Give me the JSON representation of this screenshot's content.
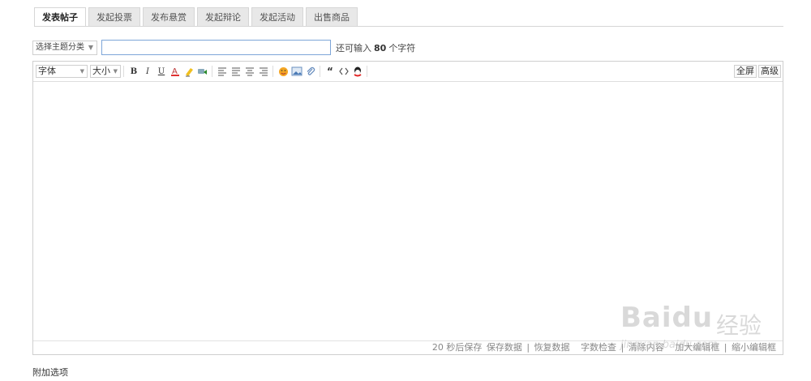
{
  "tabs": [
    {
      "label": "发表帖子",
      "active": true
    },
    {
      "label": "发起投票",
      "active": false
    },
    {
      "label": "发布悬赏",
      "active": false
    },
    {
      "label": "发起辩论",
      "active": false
    },
    {
      "label": "发起活动",
      "active": false
    },
    {
      "label": "出售商品",
      "active": false
    }
  ],
  "subject": {
    "category_select": "选择主题分类",
    "title_value": "",
    "remain_prefix": "还可输入",
    "remain_count": "80",
    "remain_suffix": "个字符"
  },
  "toolbar": {
    "font_select": "字体",
    "size_select": "大小",
    "bold": "B",
    "italic": "I",
    "underline": "U",
    "fullscreen": "全屏",
    "advanced": "高级"
  },
  "statusbar": {
    "autosave": "20 秒后保存",
    "save": "保存数据",
    "restore": "恢复数据",
    "count": "字数检查",
    "clear": "清除内容",
    "enlarge": "加大编辑框",
    "shrink": "缩小编辑框",
    "sep": "|"
  },
  "extra_options": "附加选项",
  "watermark": {
    "logo": "Baidu",
    "brand": "经验",
    "url": "jingyan.baidu.com"
  },
  "colors": {
    "tab_bg": "#e8e8e8",
    "input_border": "#7ea6d8",
    "border": "#cfcfcf"
  }
}
